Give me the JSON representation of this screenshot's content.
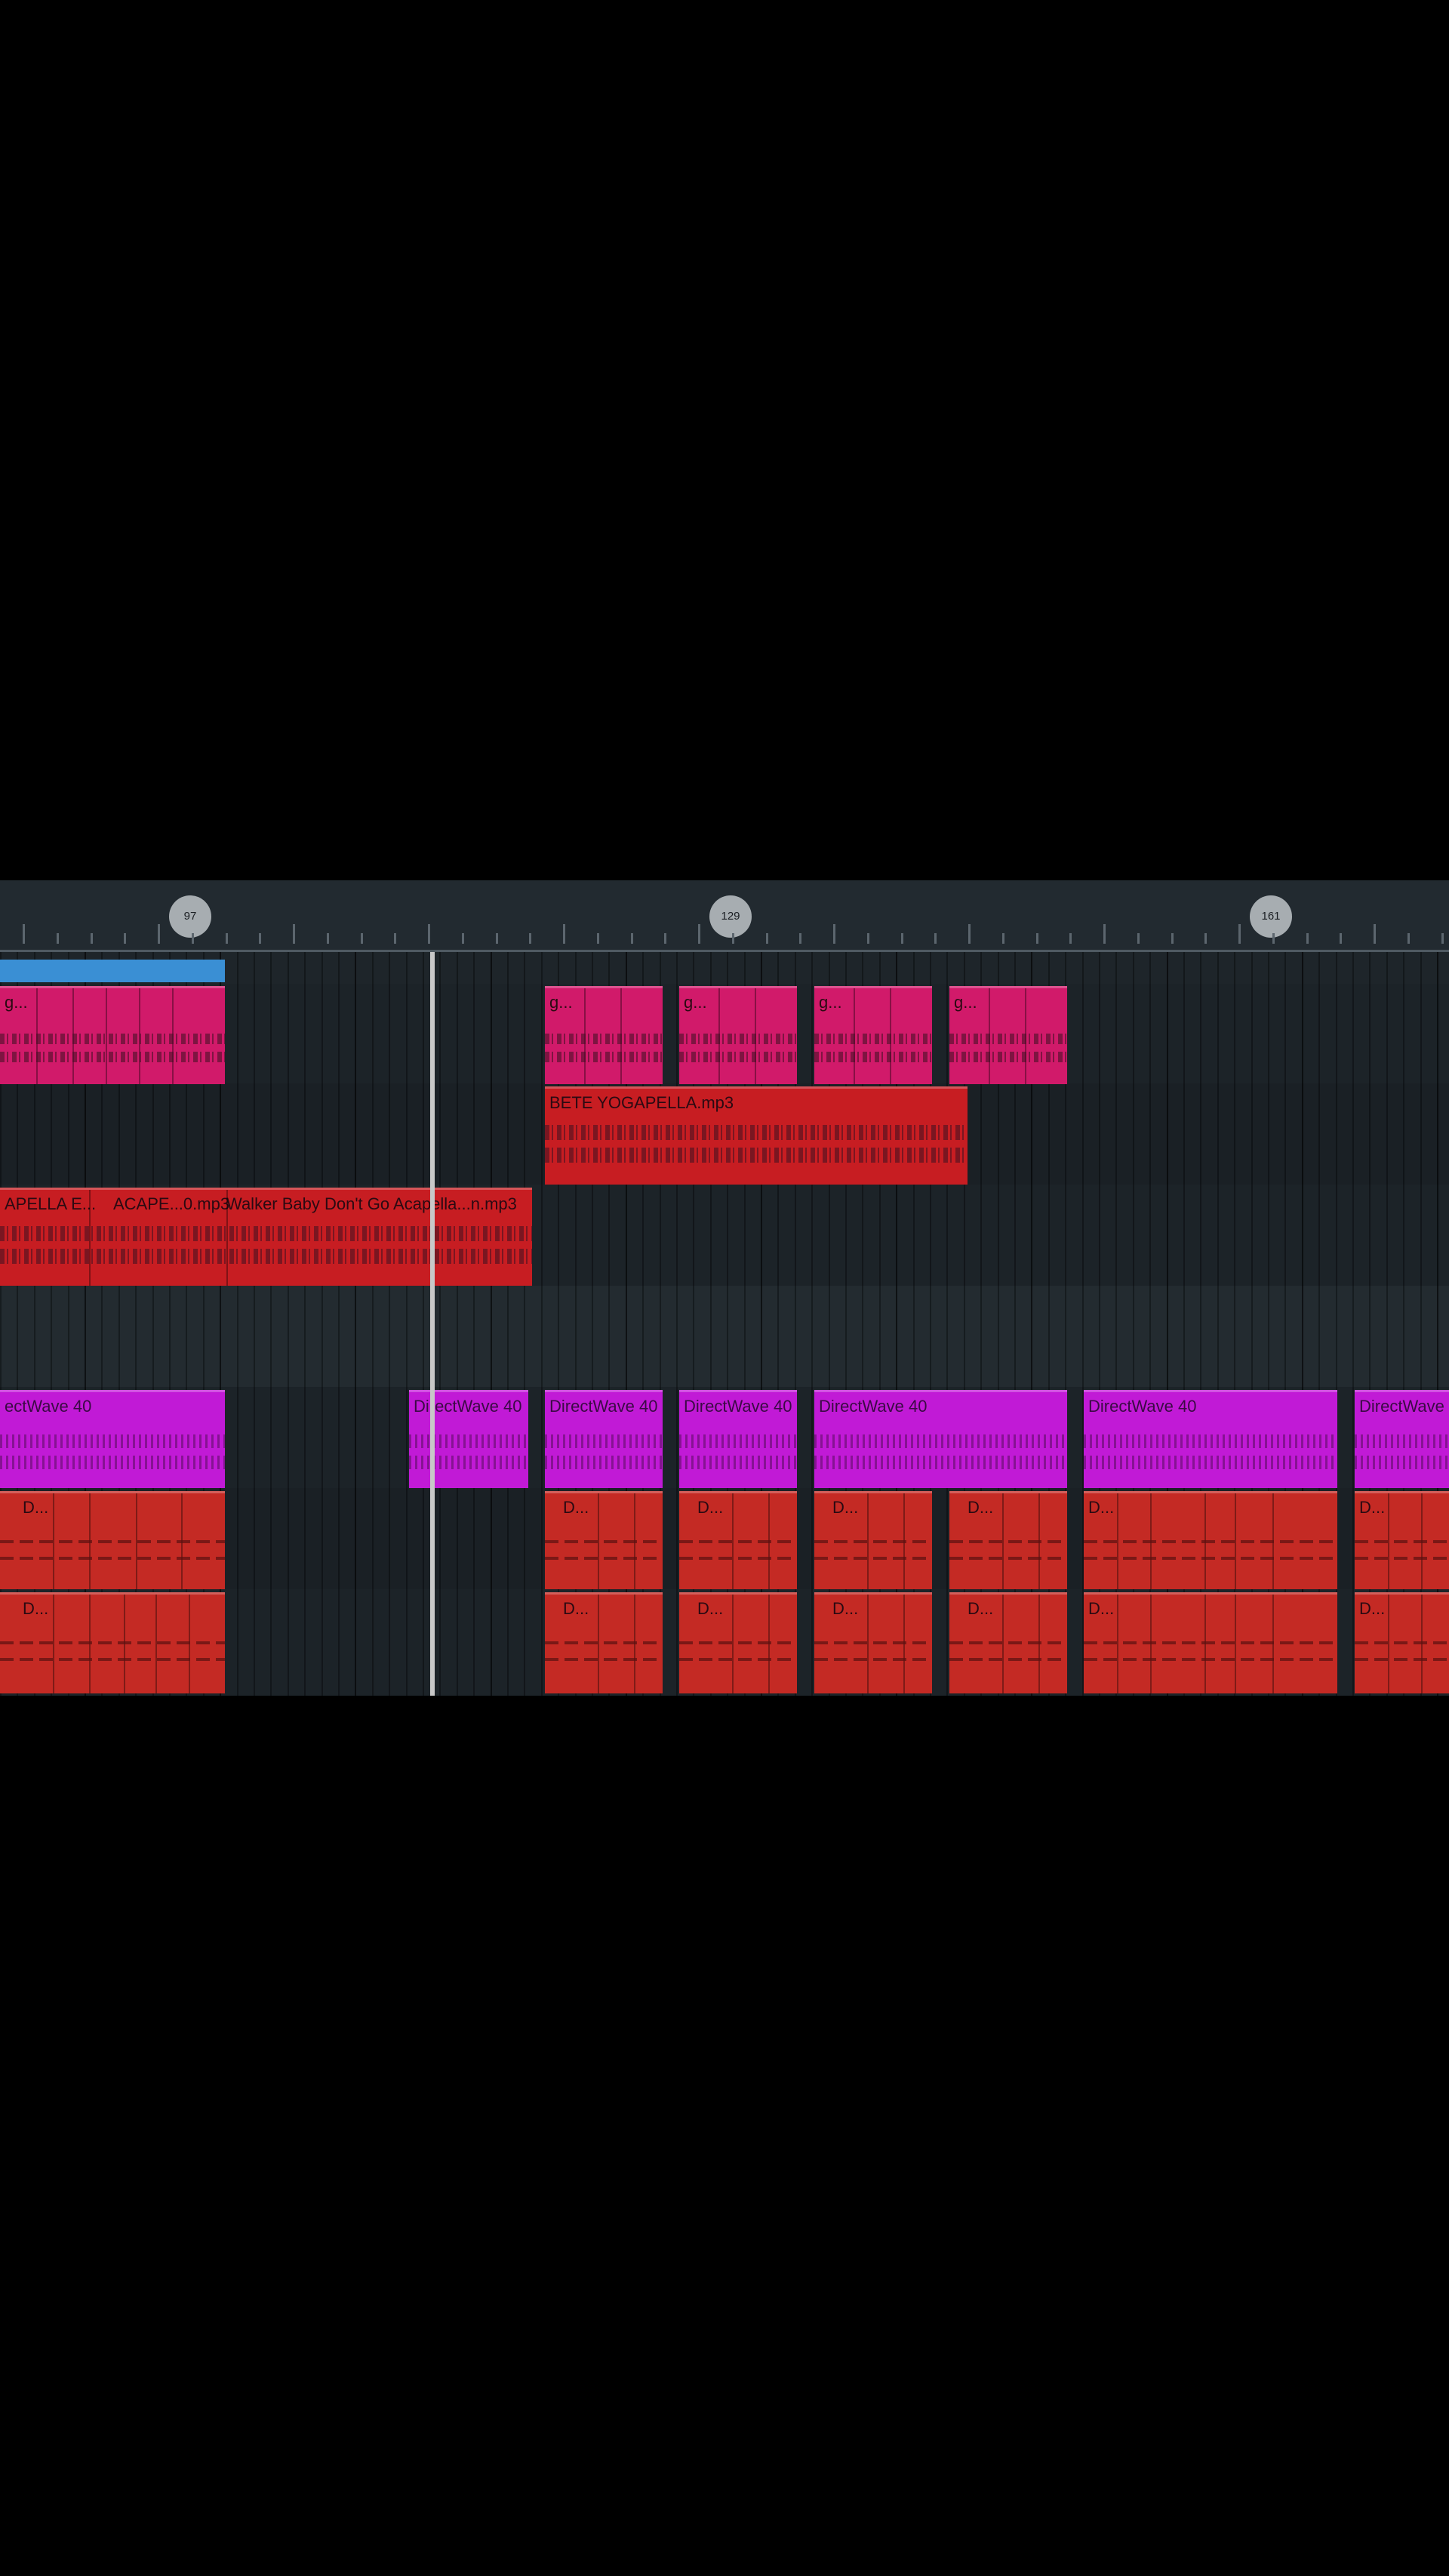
{
  "ruler": {
    "markers": [
      "97",
      "129",
      "161"
    ]
  },
  "tracks": {
    "audio_clip_1": "BETE YOGAPELLA.mp3",
    "audio_clip_2a": "APELLA E...",
    "audio_clip_2b": "ACAPE...0.mp3",
    "audio_clip_2c": "Walker Baby Don't Go Acapella...n.mp3",
    "pattern_label_short": "g...",
    "directwave_label": "DirectWave 40",
    "directwave_label_cut": "ectWave 40",
    "directwave_label_cut2": "DirectWave",
    "drum_label": "D..."
  },
  "colors": {
    "background": "#1c2227",
    "pink_clip": "#d11a6a",
    "red_clip": "#c71d22",
    "purple_clip": "#c11ad6",
    "blue_clip": "#3a8fd4",
    "playhead": "#c8c8c8"
  }
}
